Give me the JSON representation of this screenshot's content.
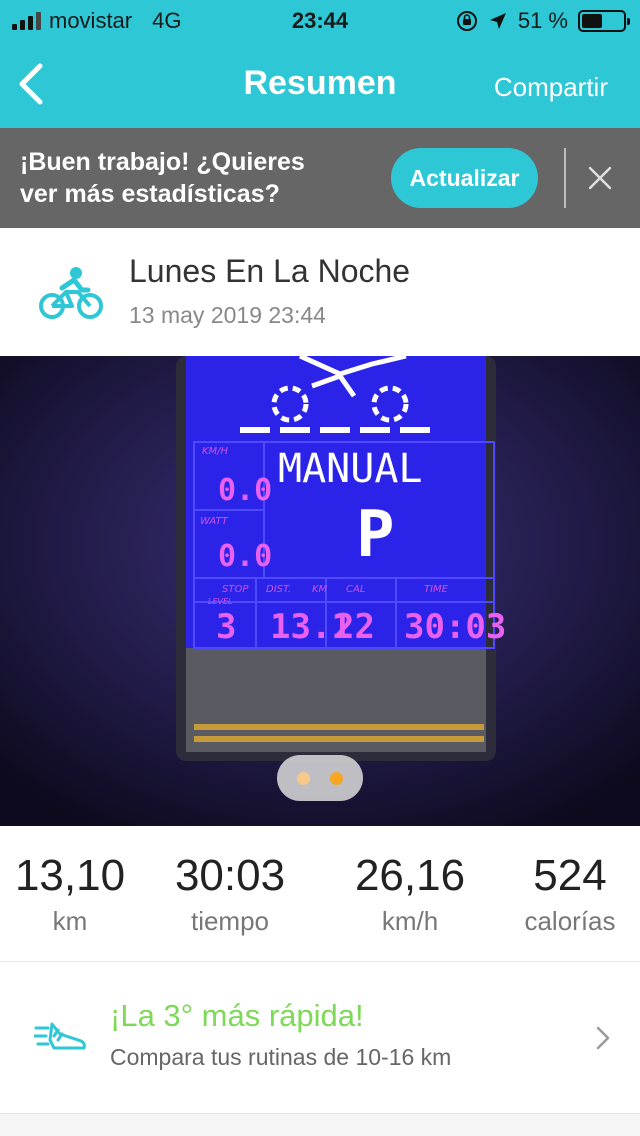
{
  "status_bar": {
    "carrier": "movistar",
    "network": "4G",
    "time": "23:44",
    "battery": "51 %"
  },
  "nav": {
    "title": "Resumen",
    "share_label": "Compartir"
  },
  "banner": {
    "line1": "¡Buen trabajo! ¿Quieres",
    "line2": "ver más estadísticas?",
    "upgrade_label": "Actualizar"
  },
  "activity": {
    "name": "Lunes En La Noche",
    "date": "13 may 2019 23:44",
    "icon": "cycling-icon"
  },
  "photo": {
    "display_labels": [
      "KM/H",
      "WATT",
      "MANUAL",
      "P",
      "STOP",
      "LEVEL",
      "DIST.",
      "KM",
      "CAL",
      "TIME"
    ],
    "speed": "0.0",
    "watt": "0.0",
    "level": "3",
    "distance": "13.1",
    "cal": "22",
    "time": "30:03",
    "pager_active": 2,
    "pager_total": 2
  },
  "stats": [
    {
      "value": "13,10",
      "unit": "km"
    },
    {
      "value": "30:03",
      "unit": "tiempo"
    },
    {
      "value": "26,16",
      "unit": "km/h"
    },
    {
      "value": "524",
      "unit": "calorías"
    }
  ],
  "insight": {
    "headline": "¡La 3° más rápida!",
    "subtitle": "Compara tus rutinas de 10-16 km",
    "icon": "running-shoe-icon"
  },
  "colors": {
    "brand": "#2ec7d6",
    "banner_bg": "#666666",
    "highlight_green": "#7ed957",
    "pager_active": "#f5a623"
  }
}
